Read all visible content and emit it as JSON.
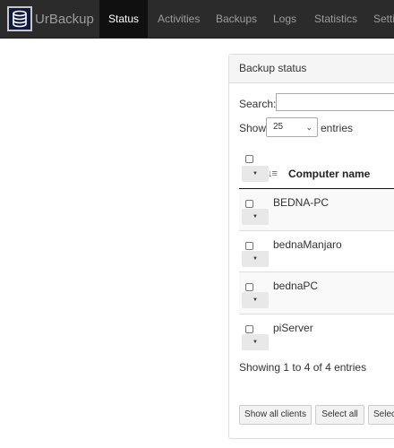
{
  "navbar": {
    "brand": "UrBackup",
    "items": [
      "Status",
      "Activities",
      "Backups",
      "Logs",
      "Statistics",
      "Setti"
    ]
  },
  "panel": {
    "title": "Backup status",
    "search_label": "Search:",
    "search_value": "",
    "show_label": "Show",
    "entries_value": "25",
    "entries_label": "entries",
    "column_header": "Computer name",
    "rows": [
      {
        "name": "BEDNA-PC"
      },
      {
        "name": "bednaManjaro"
      },
      {
        "name": "bednaPC"
      },
      {
        "name": "piServer"
      }
    ],
    "info": "Showing 1 to 4 of 4 entries",
    "buttons": [
      "Show all clients",
      "Select all",
      "Select"
    ]
  },
  "colors": {
    "navbar_bg": "#2b2b2b",
    "navbar_active_bg": "#101010",
    "navbar_text": "#9d9d9d",
    "panel_heading_bg": "#f5f5f5"
  }
}
